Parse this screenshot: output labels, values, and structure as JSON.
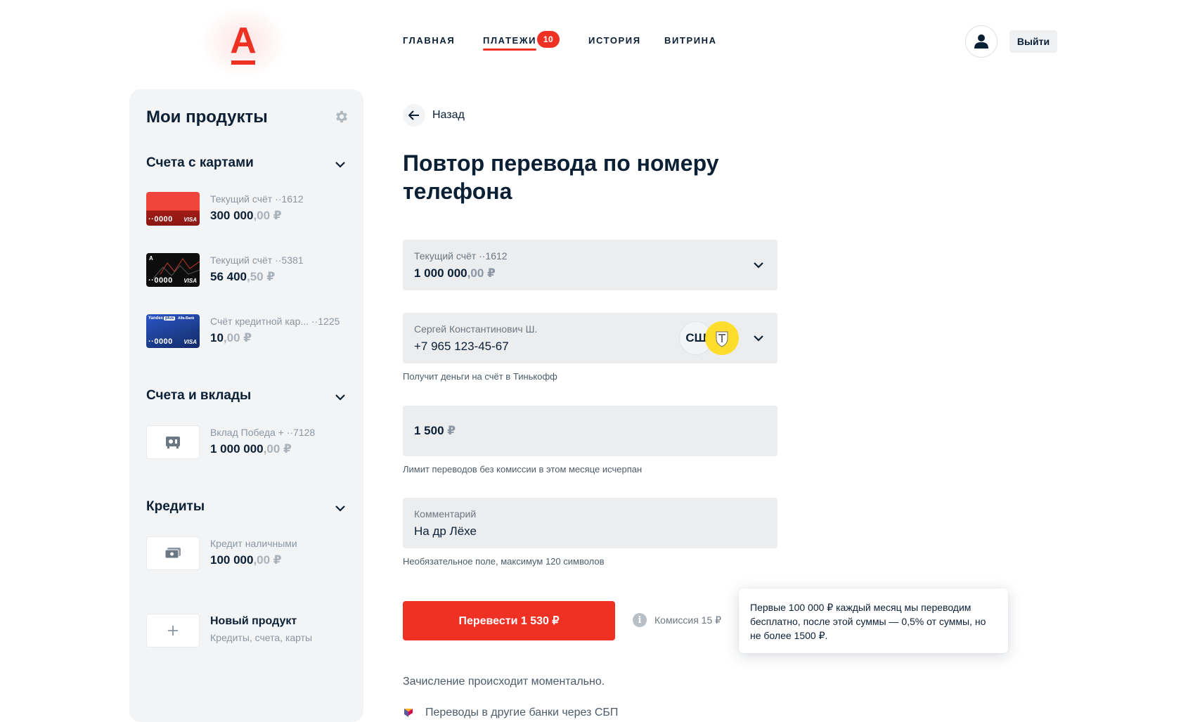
{
  "header": {
    "logo": "А",
    "nav": [
      {
        "label": "ГЛАВНАЯ"
      },
      {
        "label": "ПЛАТЕЖИ",
        "badge": "10",
        "active": true
      },
      {
        "label": "ИСТОРИЯ"
      },
      {
        "label": "ВИТРИНА"
      }
    ],
    "profile_icon": "user-icon",
    "logout_label": "Выйти"
  },
  "sidebar": {
    "title": "Мои продукты",
    "settings_icon": "gear-icon",
    "cards_section": {
      "title": "Счета с картами",
      "items": [
        {
          "name": "Текущий счёт ··1612",
          "amount_int": "300 000",
          "amount_frac": ",00 ₽",
          "card_number": "··0000",
          "card_brand": "VISA",
          "card_color": "#ef3124"
        },
        {
          "name": "Текущий счёт ··5381",
          "amount_int": "56 400",
          "amount_frac": ",50 ₽",
          "card_number": "··0000",
          "card_brand": "VISA",
          "card_color": "#111111"
        },
        {
          "name": "Счёт кредитной кар... ··1225",
          "amount_int": "10",
          "amount_frac": ",00 ₽",
          "card_number": "··0000",
          "card_brand": "VISA",
          "card_color": "#1c3d8c",
          "card_tags": [
            "Yandex",
            "plus",
            "Alfa-Bank"
          ]
        }
      ]
    },
    "deposits_section": {
      "title": "Счета и вклады",
      "items": [
        {
          "name": "Вклад Победа + ··7128",
          "amount_int": "1 000 000",
          "amount_frac": ",00 ₽",
          "icon": "safe-icon"
        }
      ]
    },
    "credits_section": {
      "title": "Кредиты",
      "items": [
        {
          "name": "Кредит наличными",
          "amount_int": "100 000",
          "amount_frac": ",00 ₽",
          "icon": "cash-icon"
        }
      ]
    },
    "new_product": {
      "title": "Новый продукт",
      "subtitle": "Кредиты, счета, карты",
      "icon": "plus-icon"
    }
  },
  "main": {
    "back_label": "Назад",
    "title": "Повтор перевода по номеру телефона",
    "account_field": {
      "label": "Текущий счёт ··1612",
      "amount_int": "1 000 000",
      "amount_frac": ",00 ₽"
    },
    "recipient_field": {
      "label": "Сергей Константинович Ш.",
      "phone": "+7 965 123-45-67",
      "initials": "СШ",
      "bank_icon": "tinkoff-bank-icon",
      "hint": "Получит деньги на счёт в Тинькофф"
    },
    "amount_field": {
      "value": "1 500",
      "currency": "₽",
      "hint": "Лимит переводов без комиссии в этом месяце исчерпан"
    },
    "comment_field": {
      "label": "Комментарий",
      "value": "На др Лёхе",
      "hint": "Необязательное поле, максимум 120 символов"
    },
    "submit_label": "Перевести 1 530 ₽",
    "commission_label": "Комиссия 15 ₽",
    "tooltip_text": "Первые 100 000 ₽ каждый месяц мы переводим бесплатно, после этой суммы — 0,5% от суммы, но не более 1500 ₽.",
    "instant_text": "Зачисление происходит моментально.",
    "sbp_text": "Переводы в другие банки через СБП"
  },
  "colors": {
    "accent": "#ef3124",
    "text": "#0b1f35",
    "field_bg": "#ebedef",
    "sidebar_bg": "#f3f4f5",
    "tinkoff_yellow": "#ffdd2d"
  }
}
